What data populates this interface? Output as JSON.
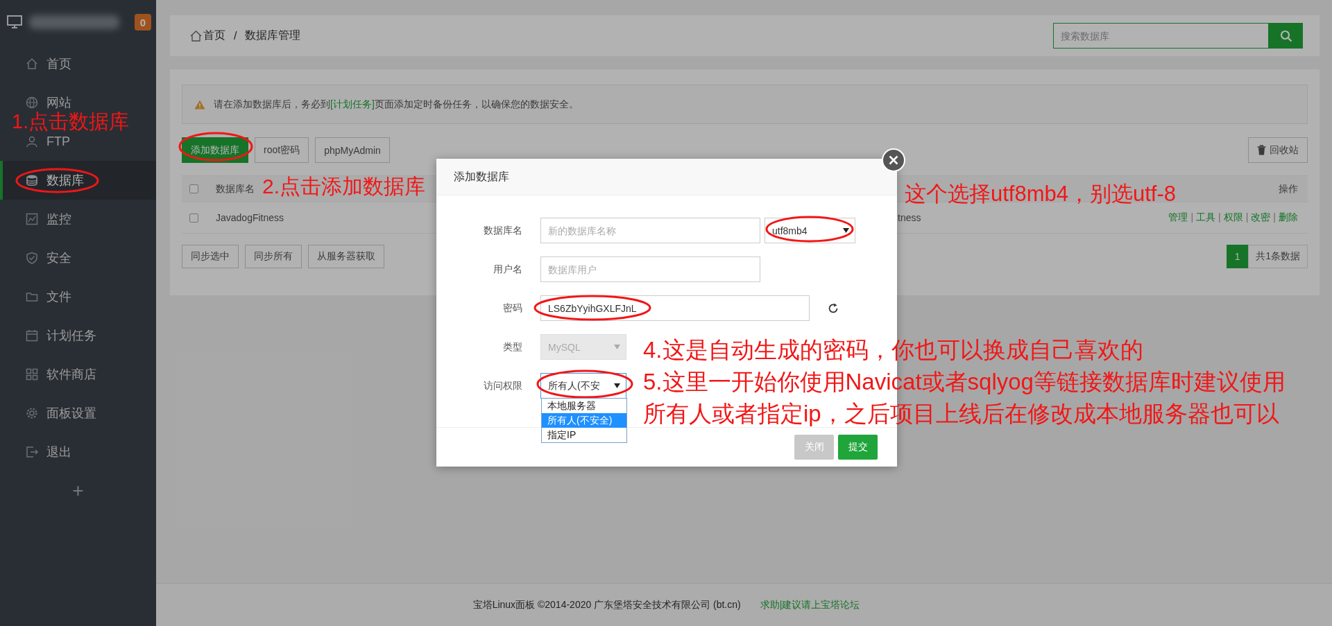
{
  "sidebar": {
    "badge": "0",
    "items": [
      {
        "label": "首页",
        "selected": false
      },
      {
        "label": "网站",
        "selected": false
      },
      {
        "label": "FTP",
        "selected": false
      },
      {
        "label": "数据库",
        "selected": true
      },
      {
        "label": "监控",
        "selected": false
      },
      {
        "label": "安全",
        "selected": false
      },
      {
        "label": "文件",
        "selected": false
      },
      {
        "label": "计划任务",
        "selected": false
      },
      {
        "label": "软件商店",
        "selected": false
      },
      {
        "label": "面板设置",
        "selected": false
      },
      {
        "label": "退出",
        "selected": false
      }
    ],
    "add_label": "+"
  },
  "header": {
    "breadcrumb": [
      "首页",
      "数据库管理"
    ],
    "separator": "/",
    "search": {
      "placeholder": "搜索数据库"
    }
  },
  "alert": {
    "before": "请在添加数据库后，务必到",
    "link": "[计划任务]",
    "after": "页面添加定时备份任务，以确保您的数据安全。"
  },
  "toolbar": {
    "buttons": [
      {
        "label": "添加数据库",
        "primary": true
      },
      {
        "label": "root密码",
        "primary": false
      },
      {
        "label": "phpMyAdmin",
        "primary": false
      }
    ],
    "recycle": "回收站"
  },
  "table": {
    "header_checked": false,
    "columns": [
      "数据库名",
      "操作"
    ],
    "rows": [
      {
        "checked": false,
        "name": "JavadogFitness",
        "column_3": "tness",
        "actions": [
          "管理",
          "工具",
          "权限",
          "改密",
          "删除"
        ],
        "separator": "|"
      }
    ]
  },
  "batch_buttons": [
    "同步选中",
    "同步所有",
    "从服务器获取"
  ],
  "pagination": {
    "pages": [
      {
        "label": "1",
        "selected": true
      }
    ],
    "total": "共1条数据"
  },
  "footer": {
    "copyright": "宝塔Linux面板 ©2014-2020 广东堡塔安全技术有限公司 (bt.cn)",
    "link": "求助|建议请上宝塔论坛"
  },
  "dialog": {
    "title": "添加数据库",
    "fields": [
      {
        "label": "数据库名",
        "kind": "text",
        "placeholder": "新的数据库名称",
        "charset": "utf8mb4"
      },
      {
        "label": "用户名",
        "kind": "text",
        "placeholder": "数据库用户"
      },
      {
        "label": "密码",
        "kind": "password",
        "value": "LS6ZbYyihGXLFJnL"
      },
      {
        "label": "类型",
        "kind": "select",
        "value": "MySQL",
        "disabled": true,
        "expanded": false
      },
      {
        "label": "访问权限",
        "kind": "select",
        "value": "所有人(不安",
        "disabled": false,
        "expanded": true,
        "options": [
          {
            "label": "本地服务器",
            "selected": false
          },
          {
            "label": "所有人(不安全)",
            "selected": true
          },
          {
            "label": "指定IP",
            "selected": false
          }
        ]
      }
    ],
    "buttons": [
      {
        "label": "关闭",
        "kind": "close"
      },
      {
        "label": "提交",
        "kind": "submit"
      }
    ]
  },
  "annotations": [
    {
      "text": "1.点击数据库"
    },
    {
      "text": "2.点击添加数据库"
    },
    {
      "text": "这个选择utf8mb4，别选utf-8"
    },
    {
      "text": "4.这是自动生成的密码，你也可以换成自己喜欢的"
    },
    {
      "text": "5.这里一开始你使用Navicat或者sqlyog等链接数据库时建议使用"
    },
    {
      "text": "所有人或者指定ip，之后项目上线后在修改成本地服务器也可以"
    }
  ]
}
